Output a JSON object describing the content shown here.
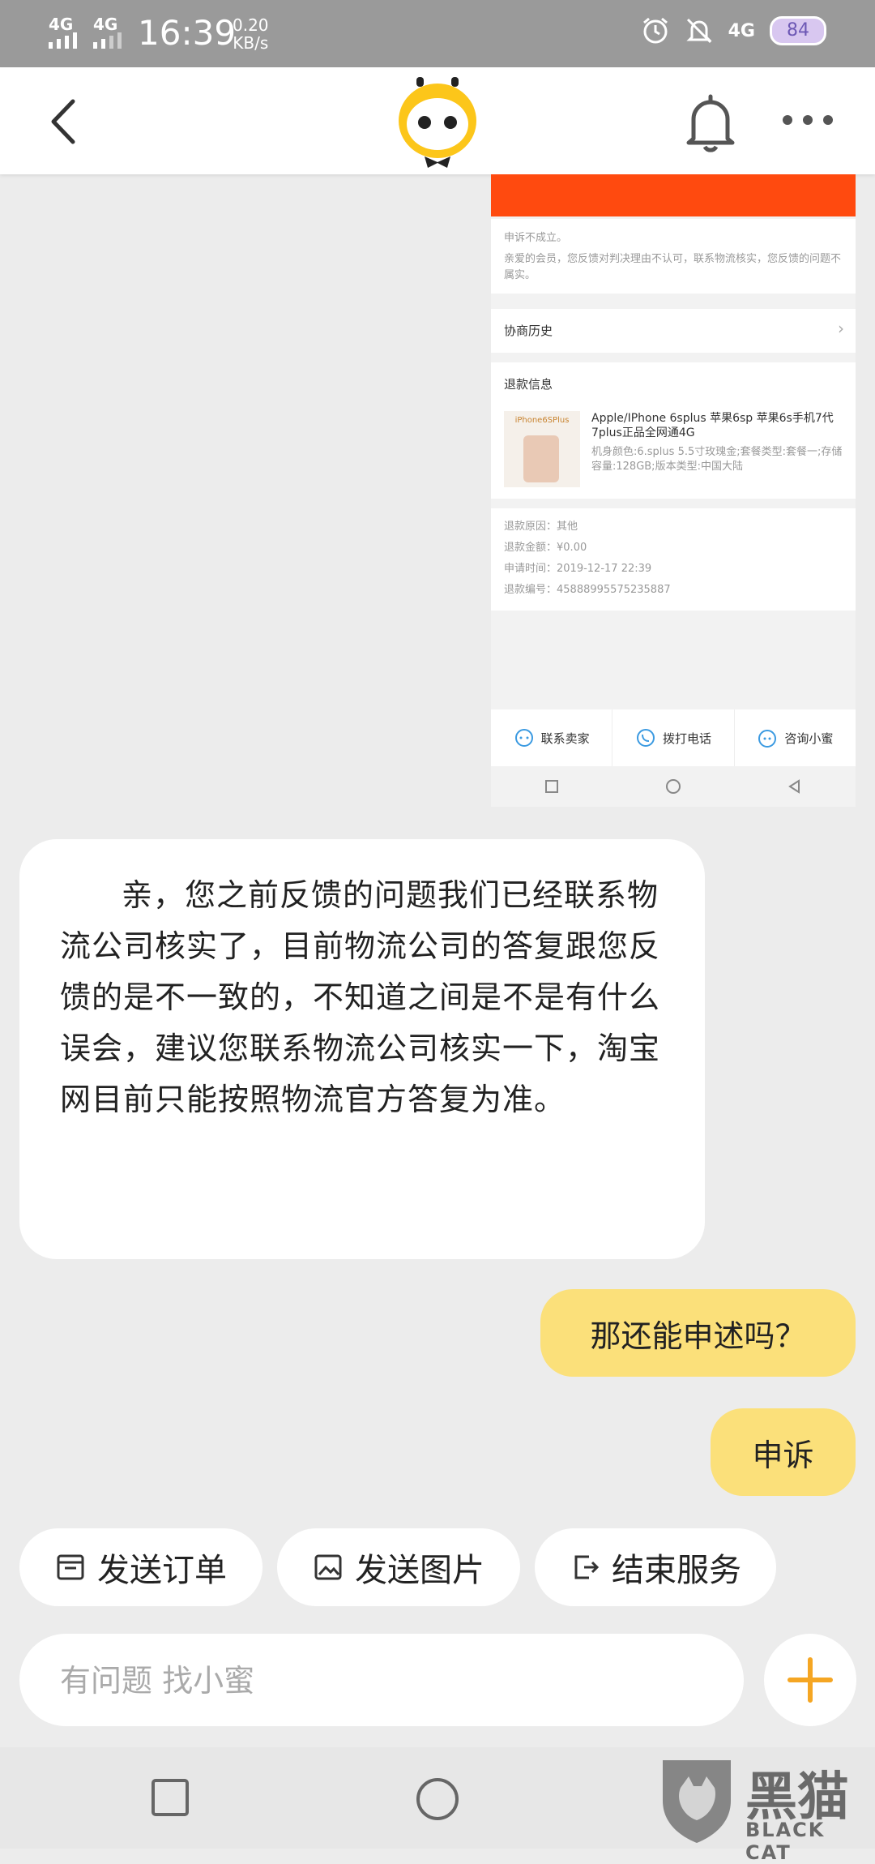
{
  "status_bar": {
    "sig1_label": "4G",
    "sig2_label": "4G",
    "time": "16:39",
    "speed_value": "0.20",
    "speed_unit": "KB/s",
    "network_label": "4G",
    "battery": "84"
  },
  "embedded": {
    "appeal_title": "申诉不成立。",
    "appeal_body": "亲爱的会员，您反馈对判决理由不认可，联系物流核实，您反馈的问题不属实。",
    "history_label": "协商历史",
    "refund_title": "退款信息",
    "product_image_text": "iPhone6SPlus",
    "product_name": "Apple/IPhone 6splus 苹果6sp 苹果6s手机7代7plus正品全网通4G",
    "product_spec": "机身颜色:6.splus 5.5寸玫瑰金;套餐类型:套餐一;存储容量:128GB;版本类型:中国大陆",
    "details": [
      {
        "label": "退款原因：",
        "value": "其他"
      },
      {
        "label": "退款金额：",
        "value": "¥0.00"
      },
      {
        "label": "申请时间：",
        "value": "2019-12-17 22:39"
      },
      {
        "label": "退款编号：",
        "value": "45888995575235887"
      }
    ],
    "contact_seller": "联系卖家",
    "call_phone": "拨打电话",
    "ask_xiaomi": "咨询小蜜"
  },
  "messages": {
    "bot_reply": "亲，您之前反馈的问题我们已经联系物流公司核实了，目前物流公司的答复跟您反馈的是不一致的，不知道之间是不是有什么误会，建议您联系物流公司核实一下，淘宝网目前只能按照物流官方答复为准。",
    "user_question": "那还能申述吗？",
    "user_short": "申诉"
  },
  "quick_actions": {
    "send_order": "发送订单",
    "send_image": "发送图片",
    "end_service": "结束服务"
  },
  "input": {
    "placeholder": "有问题 找小蜜"
  },
  "watermark": {
    "cn": "黑猫",
    "en": "BLACK CAT"
  },
  "colors": {
    "accent_yellow": "#fbe07a",
    "plus_orange": "#f5a623",
    "banner_orange": "#ff4a0f"
  }
}
